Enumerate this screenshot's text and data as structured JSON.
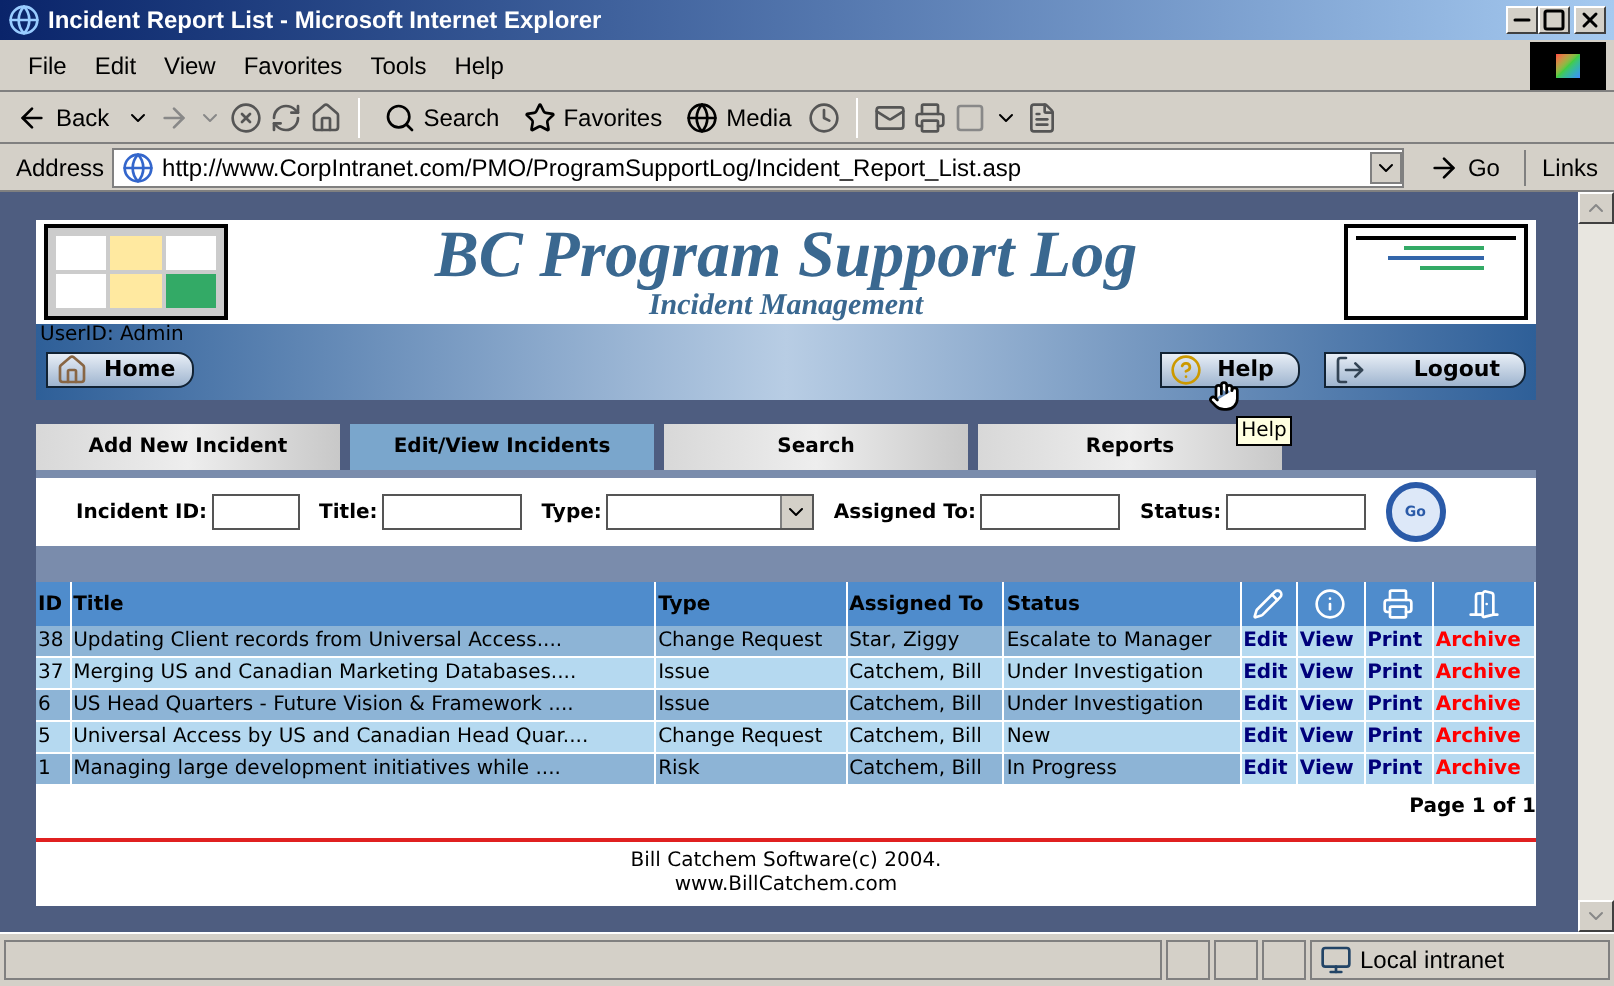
{
  "window": {
    "title": "Incident Report List - Microsoft Internet Explorer"
  },
  "menu": [
    "File",
    "Edit",
    "View",
    "Favorites",
    "Tools",
    "Help"
  ],
  "toolbar": {
    "back": "Back",
    "search": "Search",
    "favorites": "Favorites",
    "media": "Media"
  },
  "address": {
    "label": "Address",
    "url": "http://www.CorpIntranet.com/PMO/ProgramSupportLog/Incident_Report_List.asp",
    "go": "Go",
    "links": "Links"
  },
  "header": {
    "title": "BC Program Support Log",
    "subtitle": "Incident Management",
    "user": "UserID: Admin",
    "home": "Home",
    "help": "Help",
    "logout": "Logout",
    "tooltip": "Help"
  },
  "tabs": [
    {
      "label": "Add New Incident",
      "selected": false
    },
    {
      "label": "Edit/View Incidents",
      "selected": true
    },
    {
      "label": "Search",
      "selected": false
    },
    {
      "label": "Reports",
      "selected": false
    }
  ],
  "filters": [
    {
      "label": "Incident ID:",
      "kind": "text"
    },
    {
      "label": "Title:",
      "kind": "text"
    },
    {
      "label": "Type:",
      "kind": "select"
    },
    {
      "label": "Assigned To:",
      "kind": "text"
    },
    {
      "label": "Status:",
      "kind": "text"
    }
  ],
  "go": "Go",
  "table": {
    "columns": [
      "ID",
      "Title",
      "Type",
      "Assigned To",
      "Status"
    ],
    "rows": [
      {
        "id": "38",
        "title": "Updating Client records from Universal Access....",
        "type": "Change Request",
        "assigned": "Star, Ziggy",
        "status": "Escalate to Manager",
        "actions": [
          "Edit",
          "View",
          "Print",
          "Archive"
        ]
      },
      {
        "id": "37",
        "title": "Merging US and Canadian Marketing Databases....",
        "type": "Issue",
        "assigned": "Catchem, Bill",
        "status": "Under Investigation",
        "actions": [
          "Edit",
          "View",
          "Print",
          "Archive"
        ]
      },
      {
        "id": "6",
        "title": "US Head Quarters - Future Vision & Framework ....",
        "type": "Issue",
        "assigned": "Catchem, Bill",
        "status": "Under Investigation",
        "actions": [
          "Edit",
          "View",
          "Print",
          "Archive"
        ]
      },
      {
        "id": "5",
        "title": "Universal Access by US and Canadian Head Quar....",
        "type": "Change Request",
        "assigned": "Catchem, Bill",
        "status": "New",
        "actions": [
          "Edit",
          "View",
          "Print",
          "Archive"
        ]
      },
      {
        "id": "1",
        "title": "Managing large development initiatives while ....",
        "type": "Risk",
        "assigned": "Catchem, Bill",
        "status": "In Progress",
        "actions": [
          "Edit",
          "View",
          "Print",
          "Archive"
        ]
      }
    ],
    "pager": "Page 1 of 1"
  },
  "footer": [
    "Bill Catchem Software(c) 2004.",
    "www.BillCatchem.com"
  ],
  "status_bar": {
    "zone": "Local intranet"
  }
}
